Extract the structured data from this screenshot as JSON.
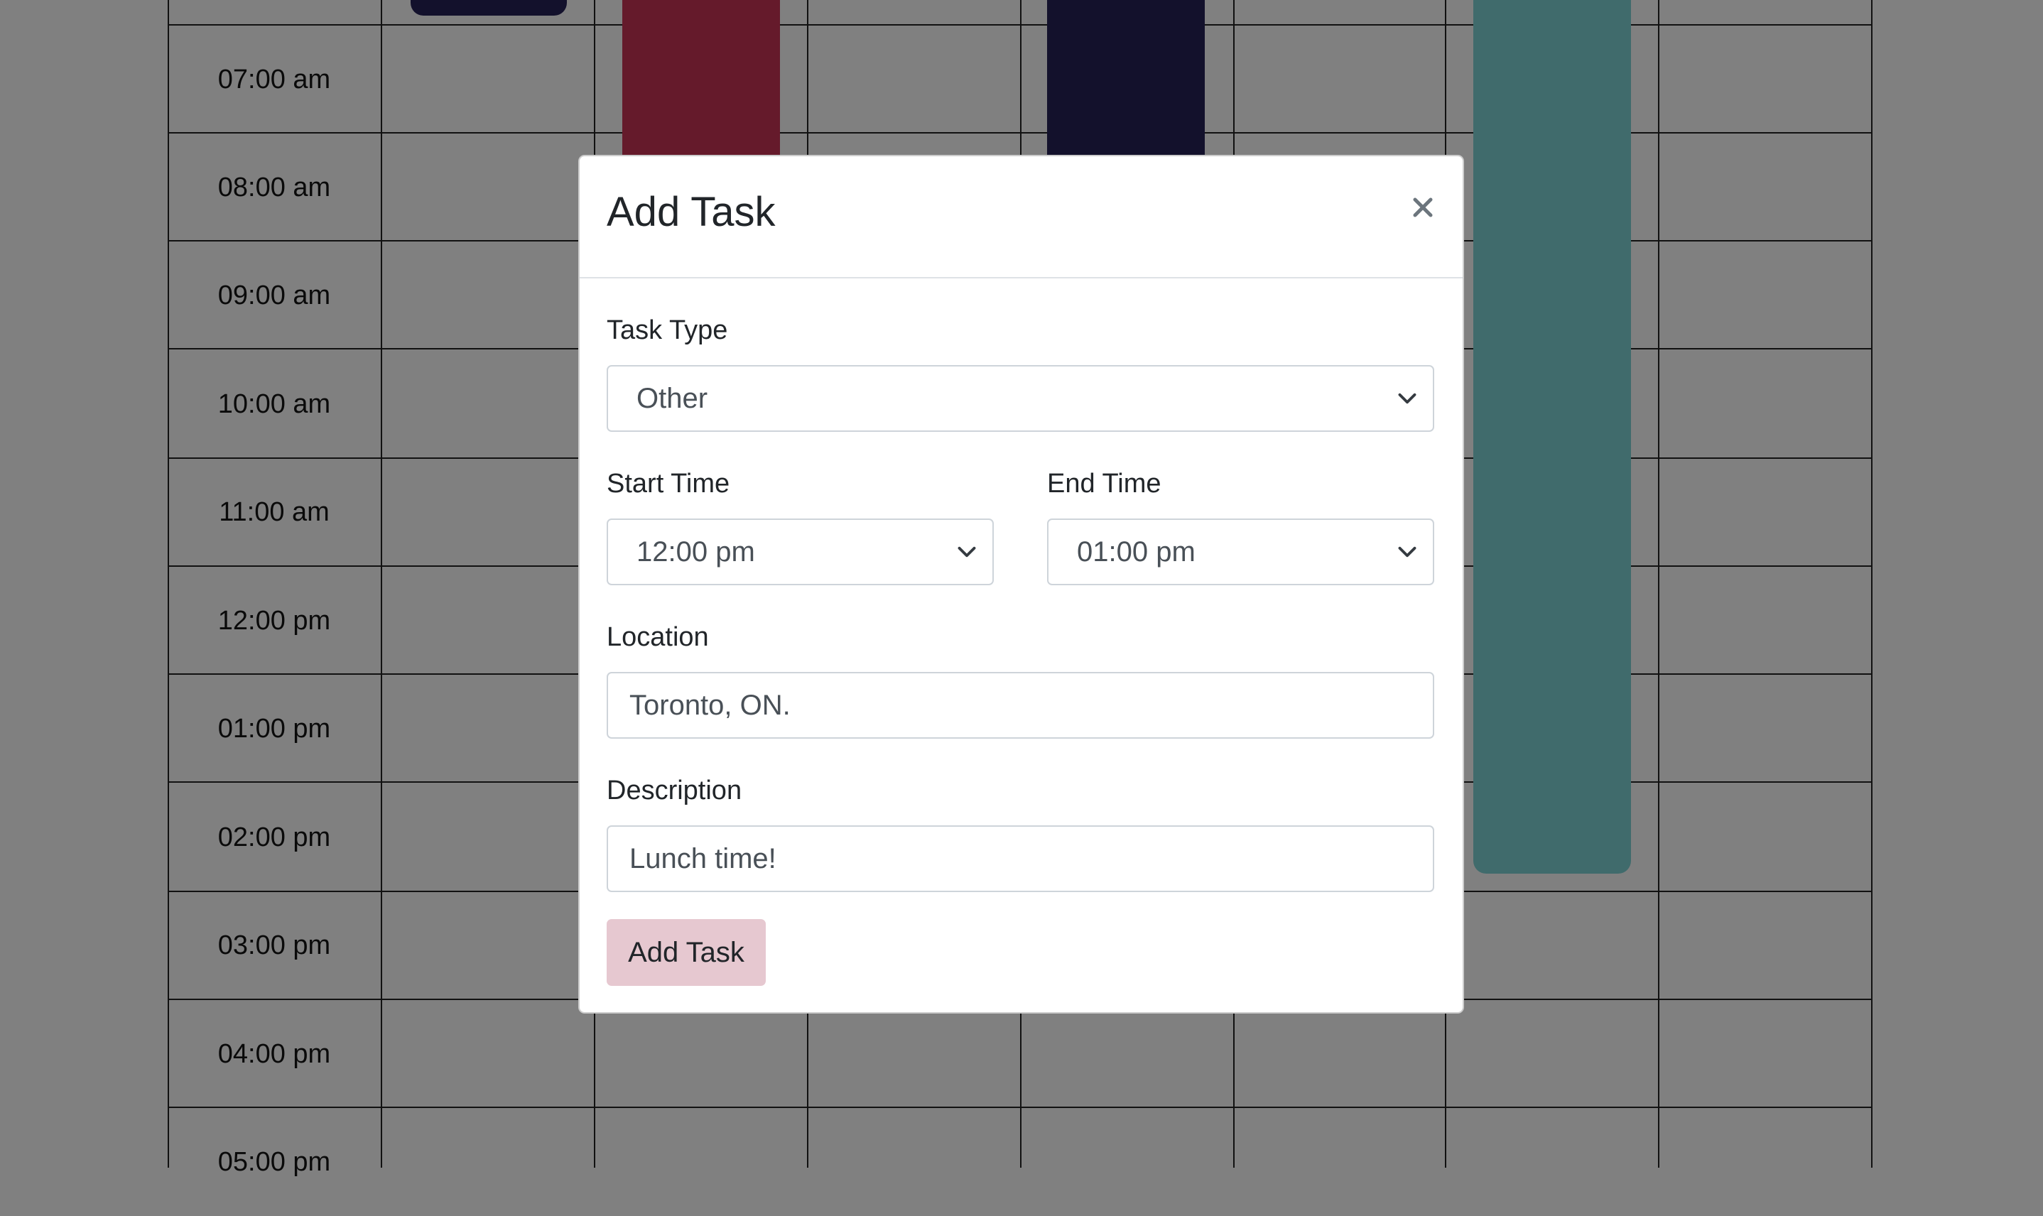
{
  "calendar": {
    "times": [
      "07:00 am",
      "08:00 am",
      "09:00 am",
      "10:00 am",
      "11:00 am",
      "12:00 pm",
      "01:00 pm",
      "02:00 pm",
      "03:00 pm",
      "04:00 pm",
      "05:00 pm"
    ],
    "event_colors": {
      "navy": "#13112c",
      "maroon": "#651a2b",
      "teal": "#406b6c"
    }
  },
  "modal": {
    "title": "Add Task",
    "close_icon": "close-icon",
    "task_type": {
      "label": "Task Type",
      "value": "Other"
    },
    "start_time": {
      "label": "Start Time",
      "value": "12:00 pm"
    },
    "end_time": {
      "label": "End Time",
      "value": "01:00 pm"
    },
    "location": {
      "label": "Location",
      "value": "Toronto, ON."
    },
    "description": {
      "label": "Description",
      "value": "Lunch time!"
    },
    "submit_label": "Add Task",
    "colors": {
      "submit_bg": "#e6c8d0",
      "backdrop": "#808080"
    }
  }
}
